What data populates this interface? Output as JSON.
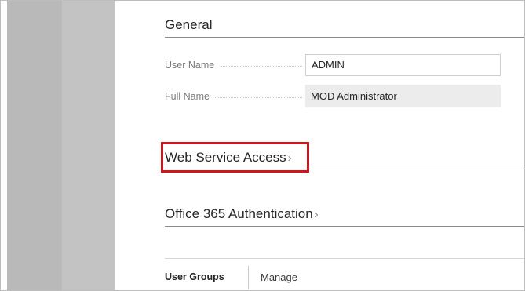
{
  "general": {
    "title": "General",
    "user_name_label": "User Name",
    "user_name_value": "ADMIN",
    "full_name_label": "Full Name",
    "full_name_value": "MOD Administrator"
  },
  "web_service_access": {
    "title": "Web Service Access",
    "chevron": "›"
  },
  "office365_auth": {
    "title": "Office 365 Authentication",
    "chevron": "›"
  },
  "user_groups": {
    "tab_label": "User Groups",
    "manage_label": "Manage"
  },
  "colors": {
    "highlight": "#d0161c",
    "sidebar_dark": "#b9b9b9",
    "sidebar_light": "#c3c3c3"
  },
  "icons": {
    "expand": "chevron-right-icon"
  }
}
